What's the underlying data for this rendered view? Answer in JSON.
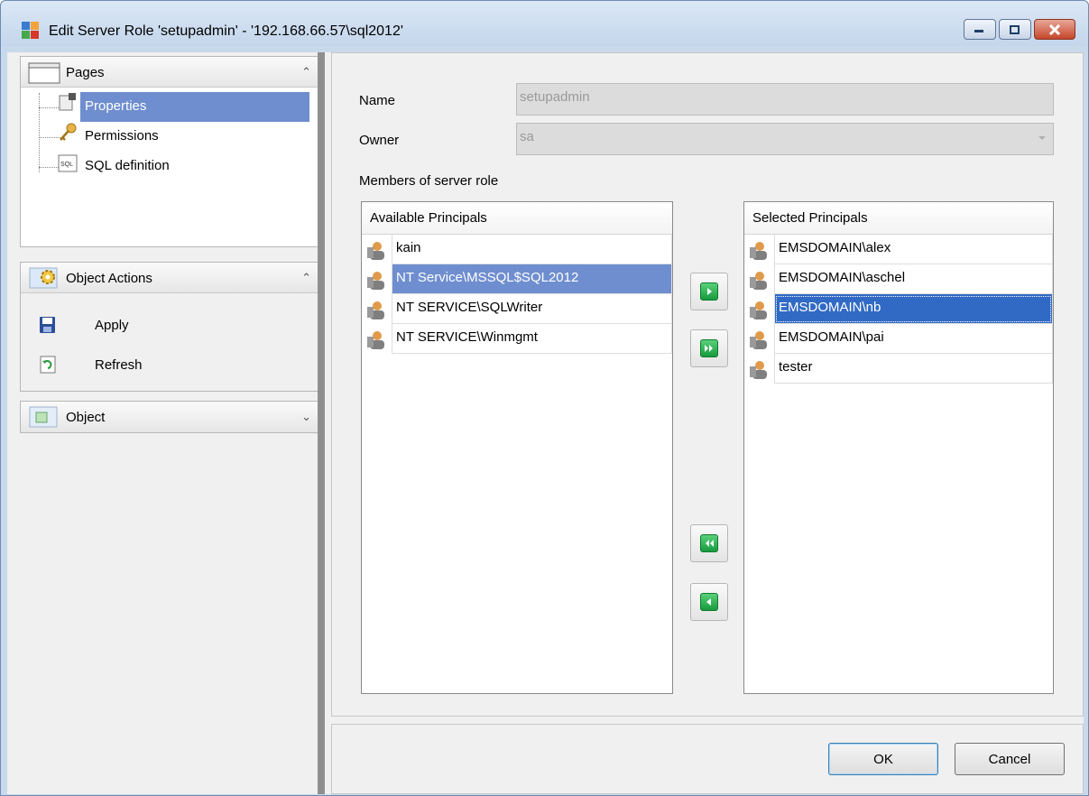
{
  "window": {
    "title": "Edit Server Role 'setupadmin' - '192.168.66.57\\sql2012'"
  },
  "nav": {
    "pages": {
      "label": "Pages",
      "items": [
        {
          "label": "Properties",
          "icon": "properties-icon",
          "selected": true
        },
        {
          "label": "Permissions",
          "icon": "key-icon"
        },
        {
          "label": "SQL definition",
          "icon": "sql-icon"
        }
      ]
    },
    "object_actions": {
      "label": "Object Actions",
      "items": [
        {
          "label": "Apply",
          "icon": "save-icon"
        },
        {
          "label": "Refresh",
          "icon": "refresh-icon"
        }
      ]
    },
    "object": {
      "label": "Object"
    }
  },
  "form": {
    "name_label": "Name",
    "name_value": "setupadmin",
    "owner_label": "Owner",
    "owner_value": "sa",
    "members_label": "Members of server role"
  },
  "available": {
    "header": "Available Principals",
    "items": [
      "kain",
      "NT Service\\MSSQL$SQL2012",
      "NT SERVICE\\SQLWriter",
      "NT SERVICE\\Winmgmt"
    ],
    "selected_index": 1
  },
  "selected": {
    "header": "Selected Principals",
    "items": [
      "EMSDOMAIN\\alex",
      "EMSDOMAIN\\aschel",
      "EMSDOMAIN\\nb",
      "EMSDOMAIN\\pai",
      "tester"
    ],
    "focused_index": 2
  },
  "buttons": {
    "ok": "OK",
    "cancel": "Cancel"
  },
  "colors": {
    "selection": "#6f8ecf",
    "focus_selection": "#316ac5",
    "arrow_green": "#179a3e"
  }
}
